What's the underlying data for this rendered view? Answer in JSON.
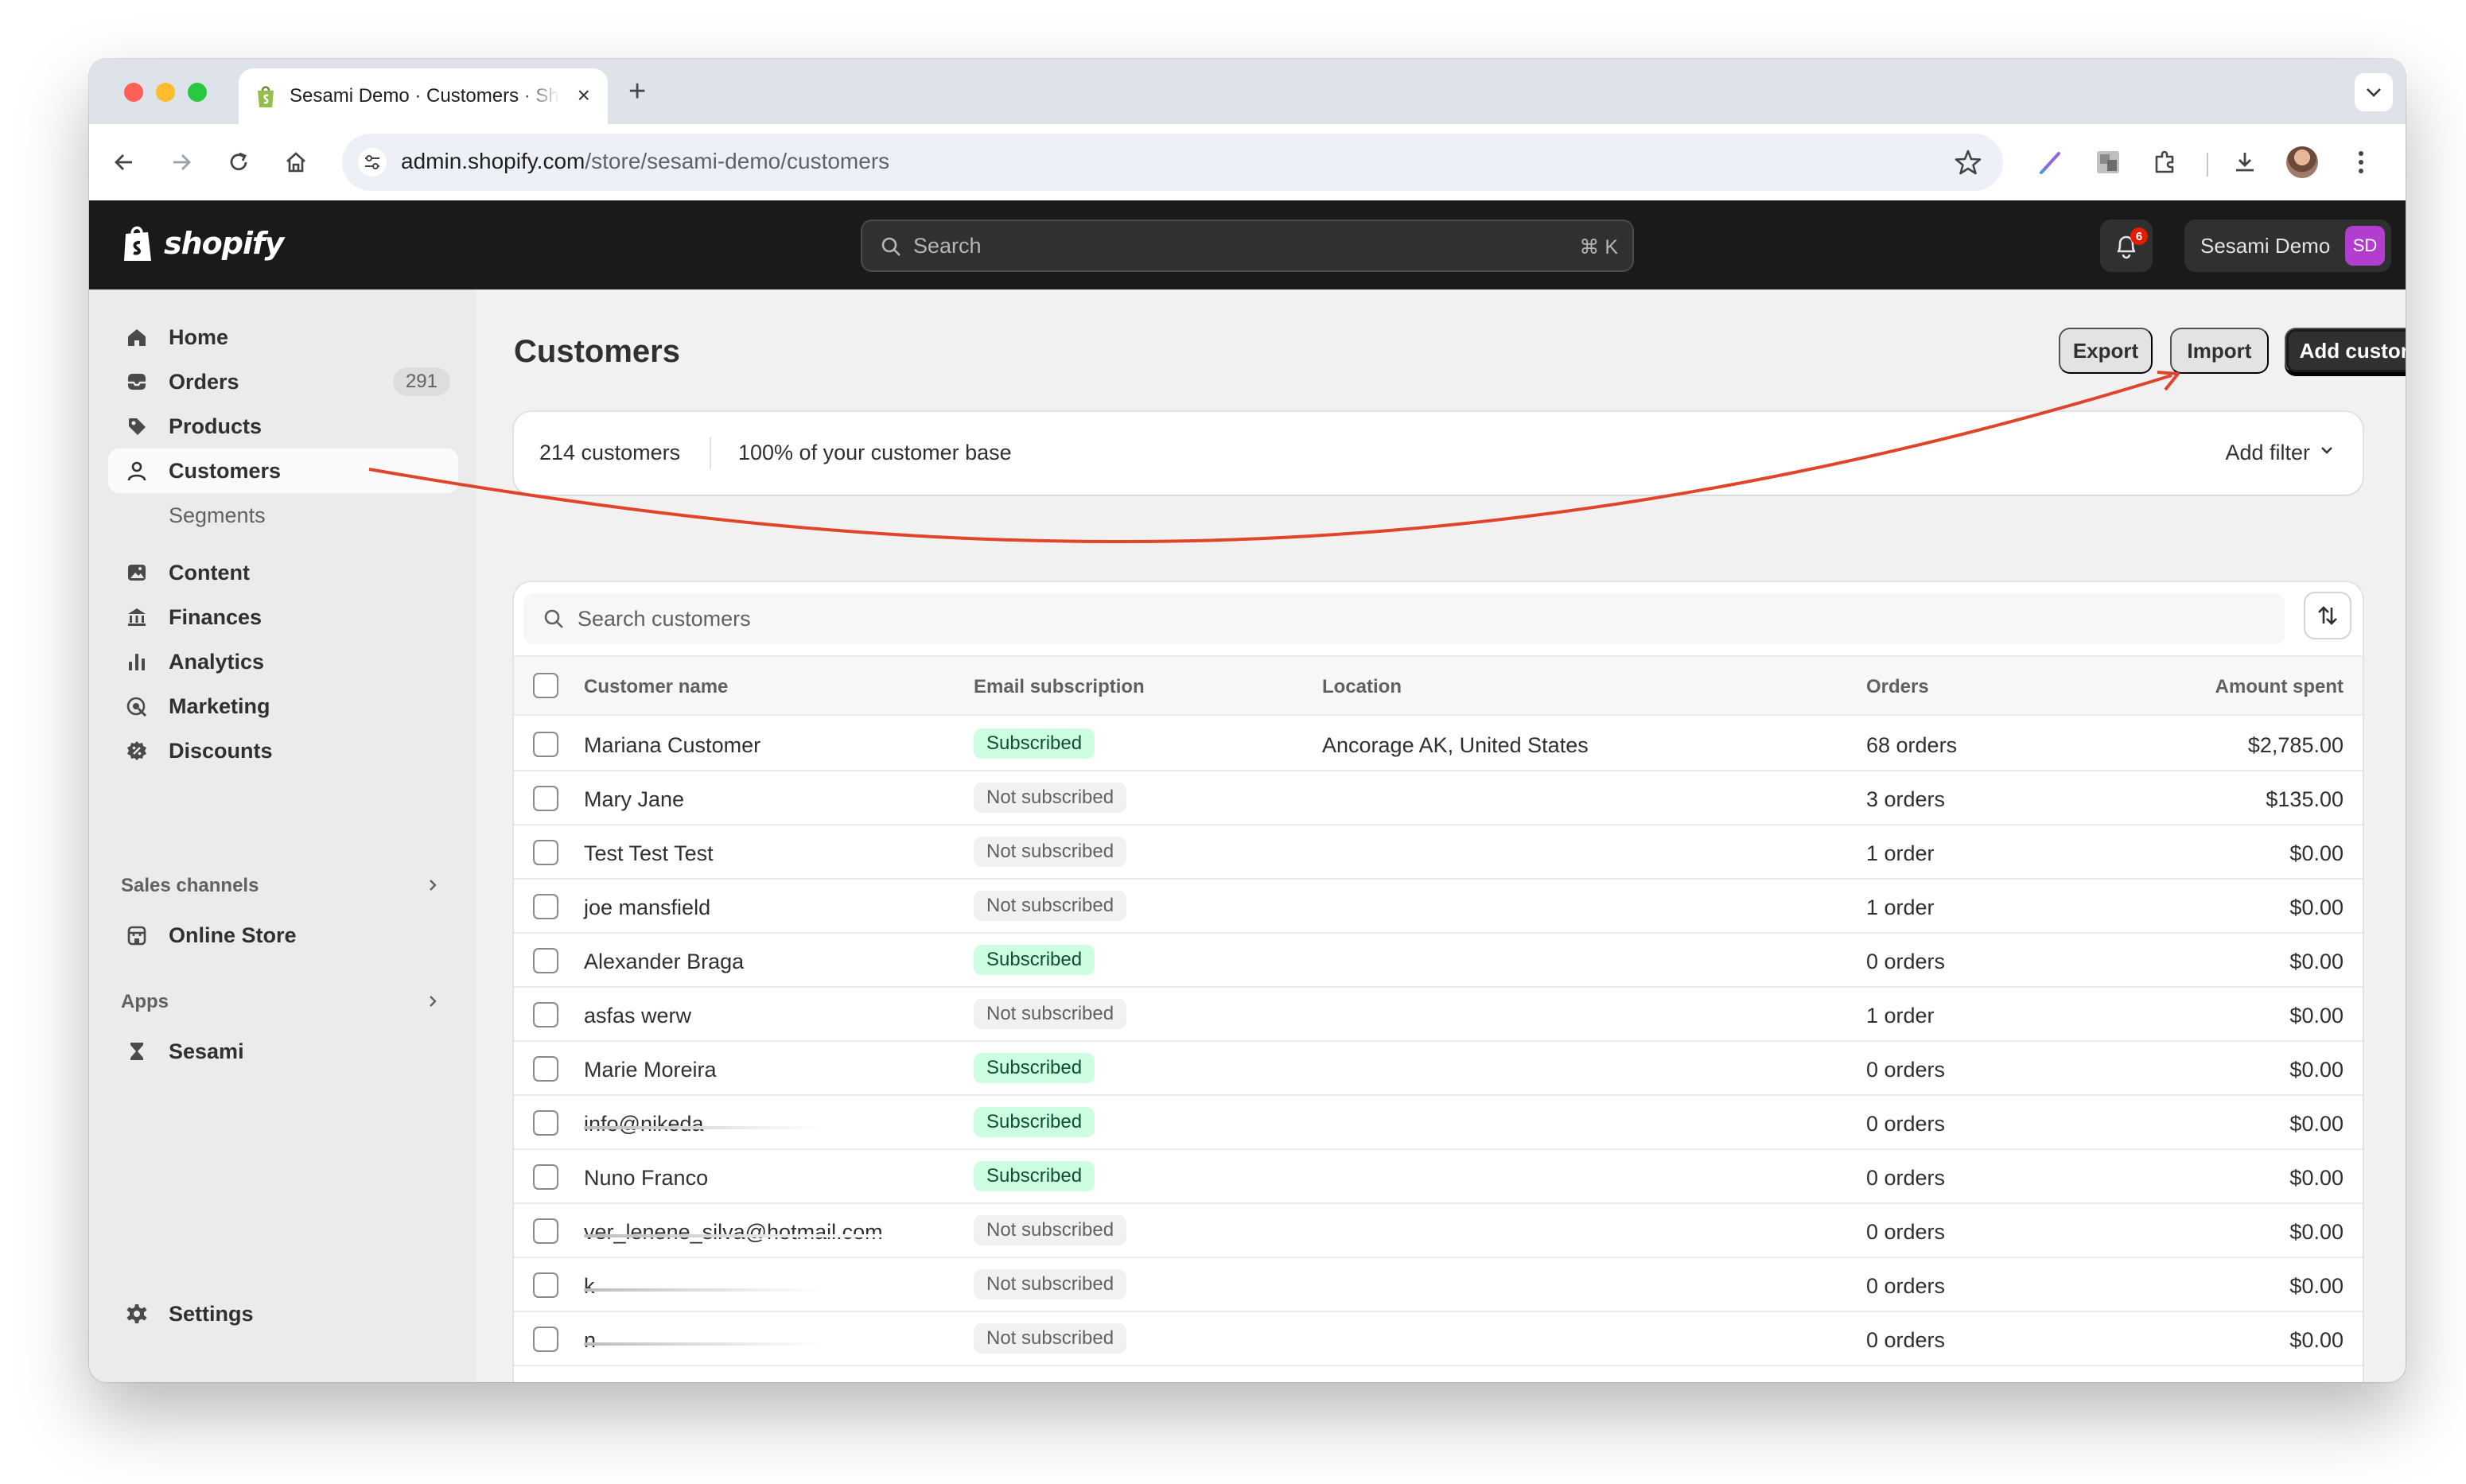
{
  "browser": {
    "tab_title": "Sesami Demo · Customers · Shopify",
    "url_host": "admin.shopify.com",
    "url_path": "/store/sesami-demo/customers",
    "new_tab": "+",
    "close_tab": "×"
  },
  "topbar": {
    "brand": "shopify",
    "search_placeholder": "Search",
    "search_shortcut": "⌘ K",
    "notification_count": "6",
    "store_name": "Sesami Demo",
    "store_initials": "SD"
  },
  "sidebar": {
    "items": [
      {
        "label": "Home",
        "icon": "home-icon"
      },
      {
        "label": "Orders",
        "icon": "inbox-icon",
        "count": "291"
      },
      {
        "label": "Products",
        "icon": "tag-icon"
      },
      {
        "label": "Customers",
        "icon": "person-icon",
        "active": true
      },
      {
        "label": "Segments"
      },
      {
        "label": "Content",
        "icon": "image-icon"
      },
      {
        "label": "Finances",
        "icon": "bank-icon"
      },
      {
        "label": "Analytics",
        "icon": "bar-chart-icon"
      },
      {
        "label": "Marketing",
        "icon": "target-icon"
      },
      {
        "label": "Discounts",
        "icon": "discount-icon"
      }
    ],
    "sales_channels_label": "Sales channels",
    "online_store_label": "Online Store",
    "apps_label": "Apps",
    "sesami_label": "Sesami",
    "settings_label": "Settings"
  },
  "page": {
    "title": "Customers",
    "export_label": "Export",
    "import_label": "Import",
    "add_customer_label": "Add customer",
    "customer_count": "214 customers",
    "customer_base": "100% of your customer base",
    "add_filter_label": "Add filter",
    "search_placeholder": "Search customers"
  },
  "table": {
    "columns": [
      "Customer name",
      "Email subscription",
      "Location",
      "Orders",
      "Amount spent"
    ],
    "rows": [
      {
        "name": "Mariana Customer",
        "subscription": "Subscribed",
        "location": "Ancorage AK, United States",
        "orders": "68 orders",
        "amount": "$2,785.00"
      },
      {
        "name": "Mary Jane",
        "subscription": "Not subscribed",
        "location": "",
        "orders": "3 orders",
        "amount": "$135.00"
      },
      {
        "name": "Test Test Test",
        "subscription": "Not subscribed",
        "location": "",
        "orders": "1 order",
        "amount": "$0.00"
      },
      {
        "name": "joe mansfield",
        "subscription": "Not subscribed",
        "location": "",
        "orders": "1 order",
        "amount": "$0.00"
      },
      {
        "name": "Alexander Braga",
        "subscription": "Subscribed",
        "location": "",
        "orders": "0 orders",
        "amount": "$0.00"
      },
      {
        "name": "asfas werw",
        "subscription": "Not subscribed",
        "location": "",
        "orders": "1 order",
        "amount": "$0.00"
      },
      {
        "name": "Marie Moreira",
        "subscription": "Subscribed",
        "location": "",
        "orders": "0 orders",
        "amount": "$0.00"
      },
      {
        "name": "info@nikeda",
        "subscription": "Subscribed",
        "location": "",
        "orders": "0 orders",
        "amount": "$0.00",
        "redacted": true
      },
      {
        "name": "Nuno Franco",
        "subscription": "Subscribed",
        "location": "",
        "orders": "0 orders",
        "amount": "$0.00"
      },
      {
        "name": "ver_lenene_silva@hotmail.com",
        "subscription": "Not subscribed",
        "location": "",
        "orders": "0 orders",
        "amount": "$0.00",
        "redacted": true
      },
      {
        "name": "k",
        "subscription": "Not subscribed",
        "location": "",
        "orders": "0 orders",
        "amount": "$0.00",
        "redacted": true
      },
      {
        "name": "n",
        "subscription": "Not subscribed",
        "location": "",
        "orders": "0 orders",
        "amount": "$0.00",
        "redacted": true
      }
    ]
  },
  "colors": {
    "accent_annotation": "#e0452b",
    "subscribed_bg": "#cdfee1",
    "primary_button": "#303030",
    "store_avatar": "#b13ecf"
  }
}
